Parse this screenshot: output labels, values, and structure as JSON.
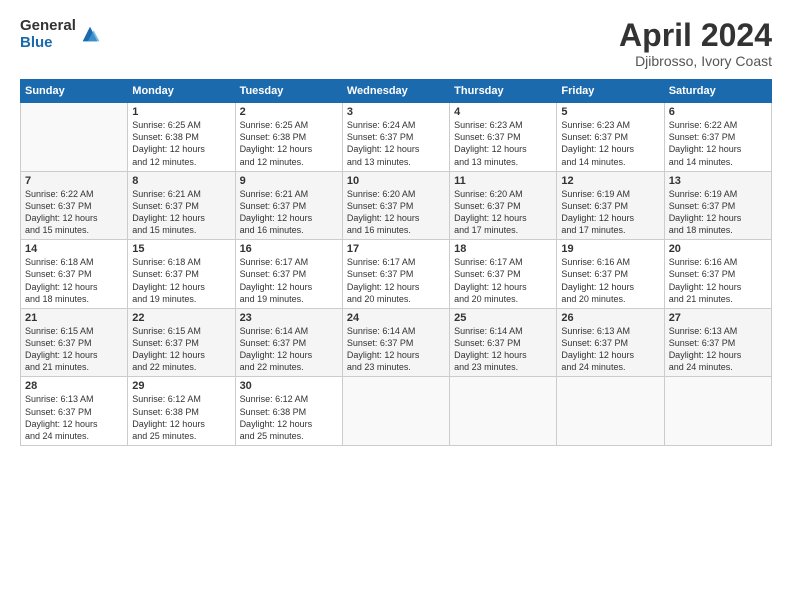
{
  "logo": {
    "general": "General",
    "blue": "Blue"
  },
  "header": {
    "month": "April 2024",
    "location": "Djibrosso, Ivory Coast"
  },
  "weekdays": [
    "Sunday",
    "Monday",
    "Tuesday",
    "Wednesday",
    "Thursday",
    "Friday",
    "Saturday"
  ],
  "weeks": [
    [
      {
        "day": "",
        "info": ""
      },
      {
        "day": "1",
        "info": "Sunrise: 6:25 AM\nSunset: 6:38 PM\nDaylight: 12 hours\nand 12 minutes."
      },
      {
        "day": "2",
        "info": "Sunrise: 6:25 AM\nSunset: 6:38 PM\nDaylight: 12 hours\nand 12 minutes."
      },
      {
        "day": "3",
        "info": "Sunrise: 6:24 AM\nSunset: 6:37 PM\nDaylight: 12 hours\nand 13 minutes."
      },
      {
        "day": "4",
        "info": "Sunrise: 6:23 AM\nSunset: 6:37 PM\nDaylight: 12 hours\nand 13 minutes."
      },
      {
        "day": "5",
        "info": "Sunrise: 6:23 AM\nSunset: 6:37 PM\nDaylight: 12 hours\nand 14 minutes."
      },
      {
        "day": "6",
        "info": "Sunrise: 6:22 AM\nSunset: 6:37 PM\nDaylight: 12 hours\nand 14 minutes."
      }
    ],
    [
      {
        "day": "7",
        "info": "Sunrise: 6:22 AM\nSunset: 6:37 PM\nDaylight: 12 hours\nand 15 minutes."
      },
      {
        "day": "8",
        "info": "Sunrise: 6:21 AM\nSunset: 6:37 PM\nDaylight: 12 hours\nand 15 minutes."
      },
      {
        "day": "9",
        "info": "Sunrise: 6:21 AM\nSunset: 6:37 PM\nDaylight: 12 hours\nand 16 minutes."
      },
      {
        "day": "10",
        "info": "Sunrise: 6:20 AM\nSunset: 6:37 PM\nDaylight: 12 hours\nand 16 minutes."
      },
      {
        "day": "11",
        "info": "Sunrise: 6:20 AM\nSunset: 6:37 PM\nDaylight: 12 hours\nand 17 minutes."
      },
      {
        "day": "12",
        "info": "Sunrise: 6:19 AM\nSunset: 6:37 PM\nDaylight: 12 hours\nand 17 minutes."
      },
      {
        "day": "13",
        "info": "Sunrise: 6:19 AM\nSunset: 6:37 PM\nDaylight: 12 hours\nand 18 minutes."
      }
    ],
    [
      {
        "day": "14",
        "info": "Sunrise: 6:18 AM\nSunset: 6:37 PM\nDaylight: 12 hours\nand 18 minutes."
      },
      {
        "day": "15",
        "info": "Sunrise: 6:18 AM\nSunset: 6:37 PM\nDaylight: 12 hours\nand 19 minutes."
      },
      {
        "day": "16",
        "info": "Sunrise: 6:17 AM\nSunset: 6:37 PM\nDaylight: 12 hours\nand 19 minutes."
      },
      {
        "day": "17",
        "info": "Sunrise: 6:17 AM\nSunset: 6:37 PM\nDaylight: 12 hours\nand 20 minutes."
      },
      {
        "day": "18",
        "info": "Sunrise: 6:17 AM\nSunset: 6:37 PM\nDaylight: 12 hours\nand 20 minutes."
      },
      {
        "day": "19",
        "info": "Sunrise: 6:16 AM\nSunset: 6:37 PM\nDaylight: 12 hours\nand 20 minutes."
      },
      {
        "day": "20",
        "info": "Sunrise: 6:16 AM\nSunset: 6:37 PM\nDaylight: 12 hours\nand 21 minutes."
      }
    ],
    [
      {
        "day": "21",
        "info": "Sunrise: 6:15 AM\nSunset: 6:37 PM\nDaylight: 12 hours\nand 21 minutes."
      },
      {
        "day": "22",
        "info": "Sunrise: 6:15 AM\nSunset: 6:37 PM\nDaylight: 12 hours\nand 22 minutes."
      },
      {
        "day": "23",
        "info": "Sunrise: 6:14 AM\nSunset: 6:37 PM\nDaylight: 12 hours\nand 22 minutes."
      },
      {
        "day": "24",
        "info": "Sunrise: 6:14 AM\nSunset: 6:37 PM\nDaylight: 12 hours\nand 23 minutes."
      },
      {
        "day": "25",
        "info": "Sunrise: 6:14 AM\nSunset: 6:37 PM\nDaylight: 12 hours\nand 23 minutes."
      },
      {
        "day": "26",
        "info": "Sunrise: 6:13 AM\nSunset: 6:37 PM\nDaylight: 12 hours\nand 24 minutes."
      },
      {
        "day": "27",
        "info": "Sunrise: 6:13 AM\nSunset: 6:37 PM\nDaylight: 12 hours\nand 24 minutes."
      }
    ],
    [
      {
        "day": "28",
        "info": "Sunrise: 6:13 AM\nSunset: 6:37 PM\nDaylight: 12 hours\nand 24 minutes."
      },
      {
        "day": "29",
        "info": "Sunrise: 6:12 AM\nSunset: 6:38 PM\nDaylight: 12 hours\nand 25 minutes."
      },
      {
        "day": "30",
        "info": "Sunrise: 6:12 AM\nSunset: 6:38 PM\nDaylight: 12 hours\nand 25 minutes."
      },
      {
        "day": "",
        "info": ""
      },
      {
        "day": "",
        "info": ""
      },
      {
        "day": "",
        "info": ""
      },
      {
        "day": "",
        "info": ""
      }
    ]
  ]
}
